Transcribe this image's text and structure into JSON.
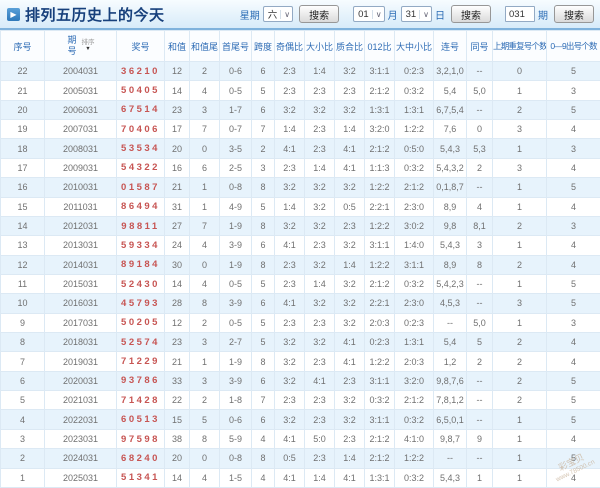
{
  "header": {
    "title": "排列五历史上的今天",
    "week_label": "星期",
    "week_value": "六",
    "month_value": "01",
    "month_label": "月",
    "day_value": "31",
    "day_label": "日",
    "issue_value": "031",
    "issue_label": "期",
    "search_button": "搜索"
  },
  "table": {
    "columns": [
      "序号",
      "期号",
      "奖号",
      "和值",
      "和值尾",
      "首尾号",
      "跨度",
      "奇偶比",
      "大小比",
      "质合比",
      "012比",
      "大中小比",
      "连号",
      "同号",
      "上期重复号个数",
      "0—9出号个数"
    ],
    "sort_label": "排序",
    "rows": [
      [
        "22",
        "2004031",
        "36210",
        "12",
        "2",
        "0-6",
        "6",
        "2:3",
        "1:4",
        "3:2",
        "3:1:1",
        "0:2:3",
        "3,2,1,0",
        "--",
        "0",
        "5"
      ],
      [
        "21",
        "2005031",
        "50405",
        "14",
        "4",
        "0-5",
        "5",
        "2:3",
        "2:3",
        "2:3",
        "2:1:2",
        "0:3:2",
        "5,4",
        "5,0",
        "1",
        "3"
      ],
      [
        "20",
        "2006031",
        "67514",
        "23",
        "3",
        "1-7",
        "6",
        "3:2",
        "3:2",
        "3:2",
        "1:3:1",
        "1:3:1",
        "6,7,5,4",
        "--",
        "2",
        "5"
      ],
      [
        "19",
        "2007031",
        "70406",
        "17",
        "7",
        "0-7",
        "7",
        "1:4",
        "2:3",
        "1:4",
        "3:2:0",
        "1:2:2",
        "7,6",
        "0",
        "3",
        "4"
      ],
      [
        "18",
        "2008031",
        "53534",
        "20",
        "0",
        "3-5",
        "2",
        "4:1",
        "2:3",
        "4:1",
        "2:1:2",
        "0:5:0",
        "5,4,3",
        "5,3",
        "1",
        "3"
      ],
      [
        "17",
        "2009031",
        "54322",
        "16",
        "6",
        "2-5",
        "3",
        "2:3",
        "1:4",
        "4:1",
        "1:1:3",
        "0:3:2",
        "5,4,3,2",
        "2",
        "3",
        "4"
      ],
      [
        "16",
        "2010031",
        "01587",
        "21",
        "1",
        "0-8",
        "8",
        "3:2",
        "3:2",
        "3:2",
        "1:2:2",
        "2:1:2",
        "0,1,8,7",
        "--",
        "1",
        "5"
      ],
      [
        "15",
        "2011031",
        "86494",
        "31",
        "1",
        "4-9",
        "5",
        "1:4",
        "3:2",
        "0:5",
        "2:2:1",
        "2:3:0",
        "8,9",
        "4",
        "1",
        "4"
      ],
      [
        "14",
        "2012031",
        "98811",
        "27",
        "7",
        "1-9",
        "8",
        "3:2",
        "3:2",
        "2:3",
        "1:2:2",
        "3:0:2",
        "9,8",
        "8,1",
        "2",
        "3"
      ],
      [
        "13",
        "2013031",
        "59334",
        "24",
        "4",
        "3-9",
        "6",
        "4:1",
        "2:3",
        "3:2",
        "3:1:1",
        "1:4:0",
        "5,4,3",
        "3",
        "1",
        "4"
      ],
      [
        "12",
        "2014031",
        "89184",
        "30",
        "0",
        "1-9",
        "8",
        "2:3",
        "3:2",
        "1:4",
        "1:2:2",
        "3:1:1",
        "8,9",
        "8",
        "2",
        "4"
      ],
      [
        "11",
        "2015031",
        "52430",
        "14",
        "4",
        "0-5",
        "5",
        "2:3",
        "1:4",
        "3:2",
        "2:1:2",
        "0:3:2",
        "5,4,2,3",
        "--",
        "1",
        "5"
      ],
      [
        "10",
        "2016031",
        "45793",
        "28",
        "8",
        "3-9",
        "6",
        "4:1",
        "3:2",
        "3:2",
        "2:2:1",
        "2:3:0",
        "4,5,3",
        "--",
        "3",
        "5"
      ],
      [
        "9",
        "2017031",
        "50205",
        "12",
        "2",
        "0-5",
        "5",
        "2:3",
        "2:3",
        "3:2",
        "2:0:3",
        "0:2:3",
        "--",
        "5,0",
        "1",
        "3"
      ],
      [
        "8",
        "2018031",
        "52574",
        "23",
        "3",
        "2-7",
        "5",
        "3:2",
        "3:2",
        "4:1",
        "0:2:3",
        "1:3:1",
        "5,4",
        "5",
        "2",
        "4"
      ],
      [
        "7",
        "2019031",
        "71229",
        "21",
        "1",
        "1-9",
        "8",
        "3:2",
        "2:3",
        "4:1",
        "1:2:2",
        "2:0:3",
        "1,2",
        "2",
        "2",
        "4"
      ],
      [
        "6",
        "2020031",
        "93786",
        "33",
        "3",
        "3-9",
        "6",
        "3:2",
        "4:1",
        "2:3",
        "3:1:1",
        "3:2:0",
        "9,8,7,6",
        "--",
        "2",
        "5"
      ],
      [
        "5",
        "2021031",
        "71428",
        "22",
        "2",
        "1-8",
        "7",
        "2:3",
        "2:3",
        "3:2",
        "0:3:2",
        "2:1:2",
        "7,8,1,2",
        "--",
        "2",
        "5"
      ],
      [
        "4",
        "2022031",
        "60513",
        "15",
        "5",
        "0-6",
        "6",
        "3:2",
        "2:3",
        "3:2",
        "3:1:1",
        "0:3:2",
        "6,5,0,1",
        "--",
        "1",
        "5"
      ],
      [
        "3",
        "2023031",
        "97598",
        "38",
        "8",
        "5-9",
        "4",
        "4:1",
        "5:0",
        "2:3",
        "2:1:2",
        "4:1:0",
        "9,8,7",
        "9",
        "1",
        "4"
      ],
      [
        "2",
        "2024031",
        "68240",
        "20",
        "0",
        "0-8",
        "8",
        "0:5",
        "2:3",
        "1:4",
        "2:1:2",
        "1:2:2",
        "--",
        "--",
        "1",
        "5"
      ],
      [
        "1",
        "2025031",
        "51341",
        "14",
        "4",
        "1-5",
        "4",
        "4:1",
        "1:4",
        "4:1",
        "1:3:1",
        "0:3:2",
        "5,4,3",
        "1",
        "1",
        "4"
      ]
    ]
  },
  "watermark": {
    "line1": "彩宝贝",
    "line2": "www.78500.cn"
  },
  "colors": {
    "accent_blue": "#2e6cb5",
    "prize_red": "#c75553",
    "row_alt_bg": "#e7f3fc",
    "topbar_border": "#7fb2dc"
  }
}
